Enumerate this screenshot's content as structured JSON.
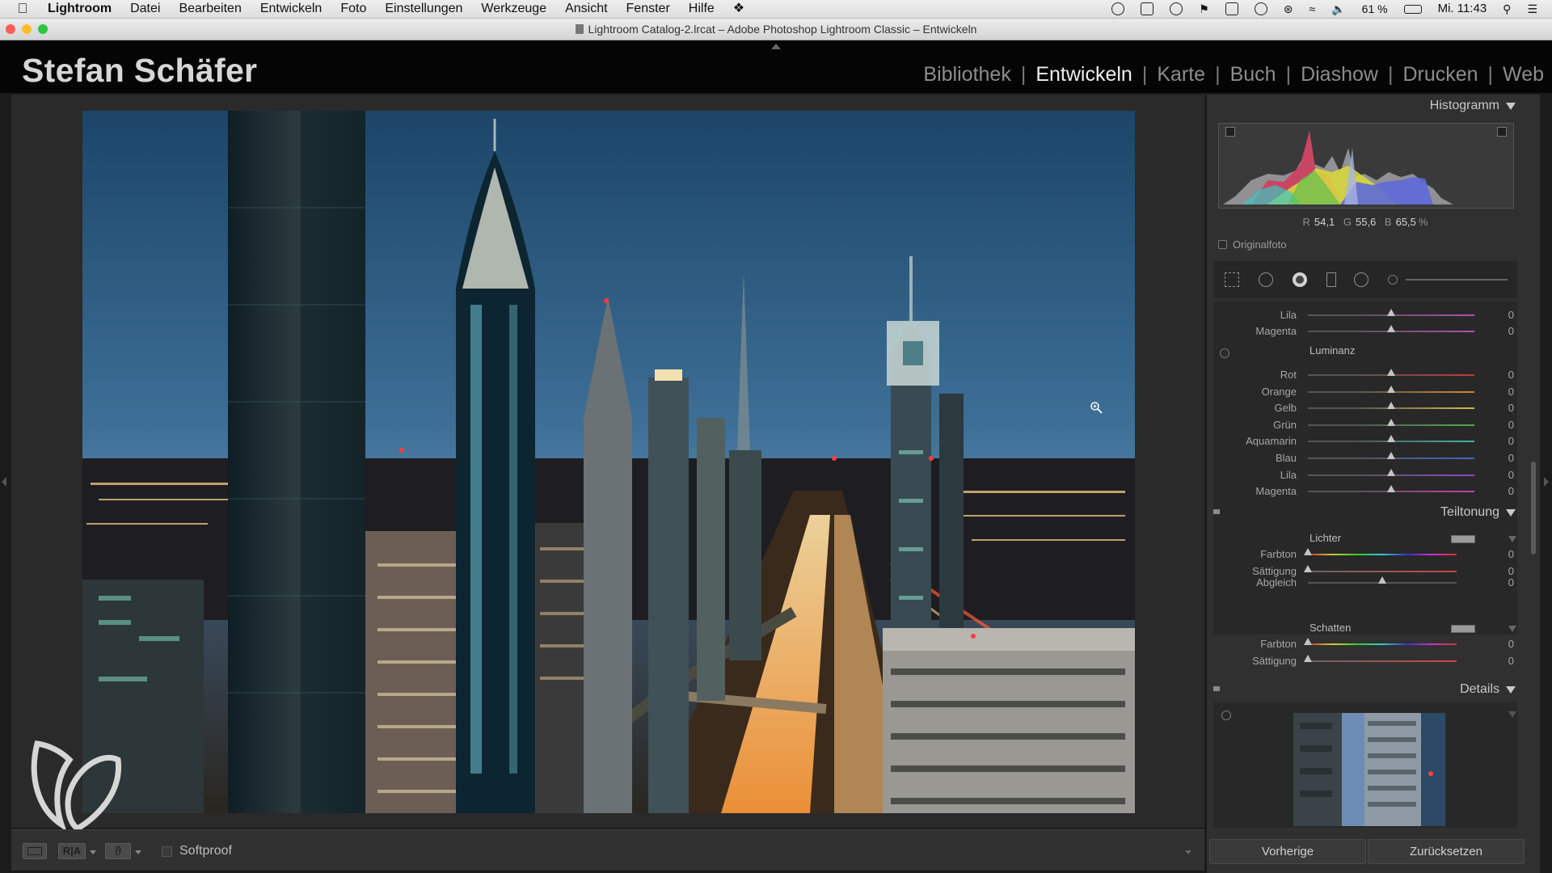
{
  "menubar": {
    "app": "Lightroom",
    "items": [
      "Datei",
      "Bearbeiten",
      "Entwickeln",
      "Foto",
      "Einstellungen",
      "Werkzeuge",
      "Ansicht",
      "Fenster",
      "Hilfe"
    ],
    "battery": "61 %",
    "clock": "Mi. 11:43"
  },
  "window": {
    "title": "Lightroom Catalog-2.lrcat – Adobe Photoshop Lightroom Classic – Entwickeln"
  },
  "identity": {
    "name": "Stefan Schäfer"
  },
  "modules": {
    "items": [
      "Bibliothek",
      "Entwickeln",
      "Karte",
      "Buch",
      "Diashow",
      "Drucken",
      "Web"
    ],
    "active": "Entwickeln"
  },
  "histogram": {
    "title": "Histogramm",
    "r_label": "R",
    "r_value": "54,1",
    "g_label": "G",
    "g_value": "55,6",
    "b_label": "B",
    "b_value": "65,5",
    "unit": "%",
    "original_label": "Originalfoto"
  },
  "hsl_partial": {
    "rows": [
      {
        "label": "Lila",
        "value": "0",
        "thumb": 0.5
      },
      {
        "label": "Magenta",
        "value": "0",
        "thumb": 0.5
      }
    ]
  },
  "luminance": {
    "title": "Luminanz",
    "rows": [
      {
        "label": "Rot",
        "value": "0",
        "thumb": 0.5,
        "color": "#c43a3a"
      },
      {
        "label": "Orange",
        "value": "0",
        "thumb": 0.5,
        "color": "#d28a2e"
      },
      {
        "label": "Gelb",
        "value": "0",
        "thumb": 0.5,
        "color": "#c9c24a"
      },
      {
        "label": "Grün",
        "value": "0",
        "thumb": 0.5,
        "color": "#4caf4c"
      },
      {
        "label": "Aquamarin",
        "value": "0",
        "thumb": 0.5,
        "color": "#3bb4a6"
      },
      {
        "label": "Blau",
        "value": "0",
        "thumb": 0.5,
        "color": "#3e67c8"
      },
      {
        "label": "Lila",
        "value": "0",
        "thumb": 0.5,
        "color": "#8a4bc8"
      },
      {
        "label": "Magenta",
        "value": "0",
        "thumb": 0.5,
        "color": "#c440a8"
      }
    ]
  },
  "split_toning": {
    "title": "Teiltonung",
    "highlights_label": "Lichter",
    "highlights": [
      {
        "label": "Farbton",
        "value": "0",
        "thumb": 0.0
      },
      {
        "label": "Sättigung",
        "value": "0",
        "thumb": 0.0
      }
    ],
    "balance": {
      "label": "Abgleich",
      "value": "0",
      "thumb": 0.5
    },
    "shadows_label": "Schatten",
    "shadows": [
      {
        "label": "Farbton",
        "value": "0",
        "thumb": 0.0
      },
      {
        "label": "Sättigung",
        "value": "0",
        "thumb": 0.0
      }
    ]
  },
  "details": {
    "title": "Details"
  },
  "toolbar": {
    "softproof_label": "Softproof"
  },
  "buttons": {
    "previous": "Vorherige",
    "reset": "Zurücksetzen"
  }
}
